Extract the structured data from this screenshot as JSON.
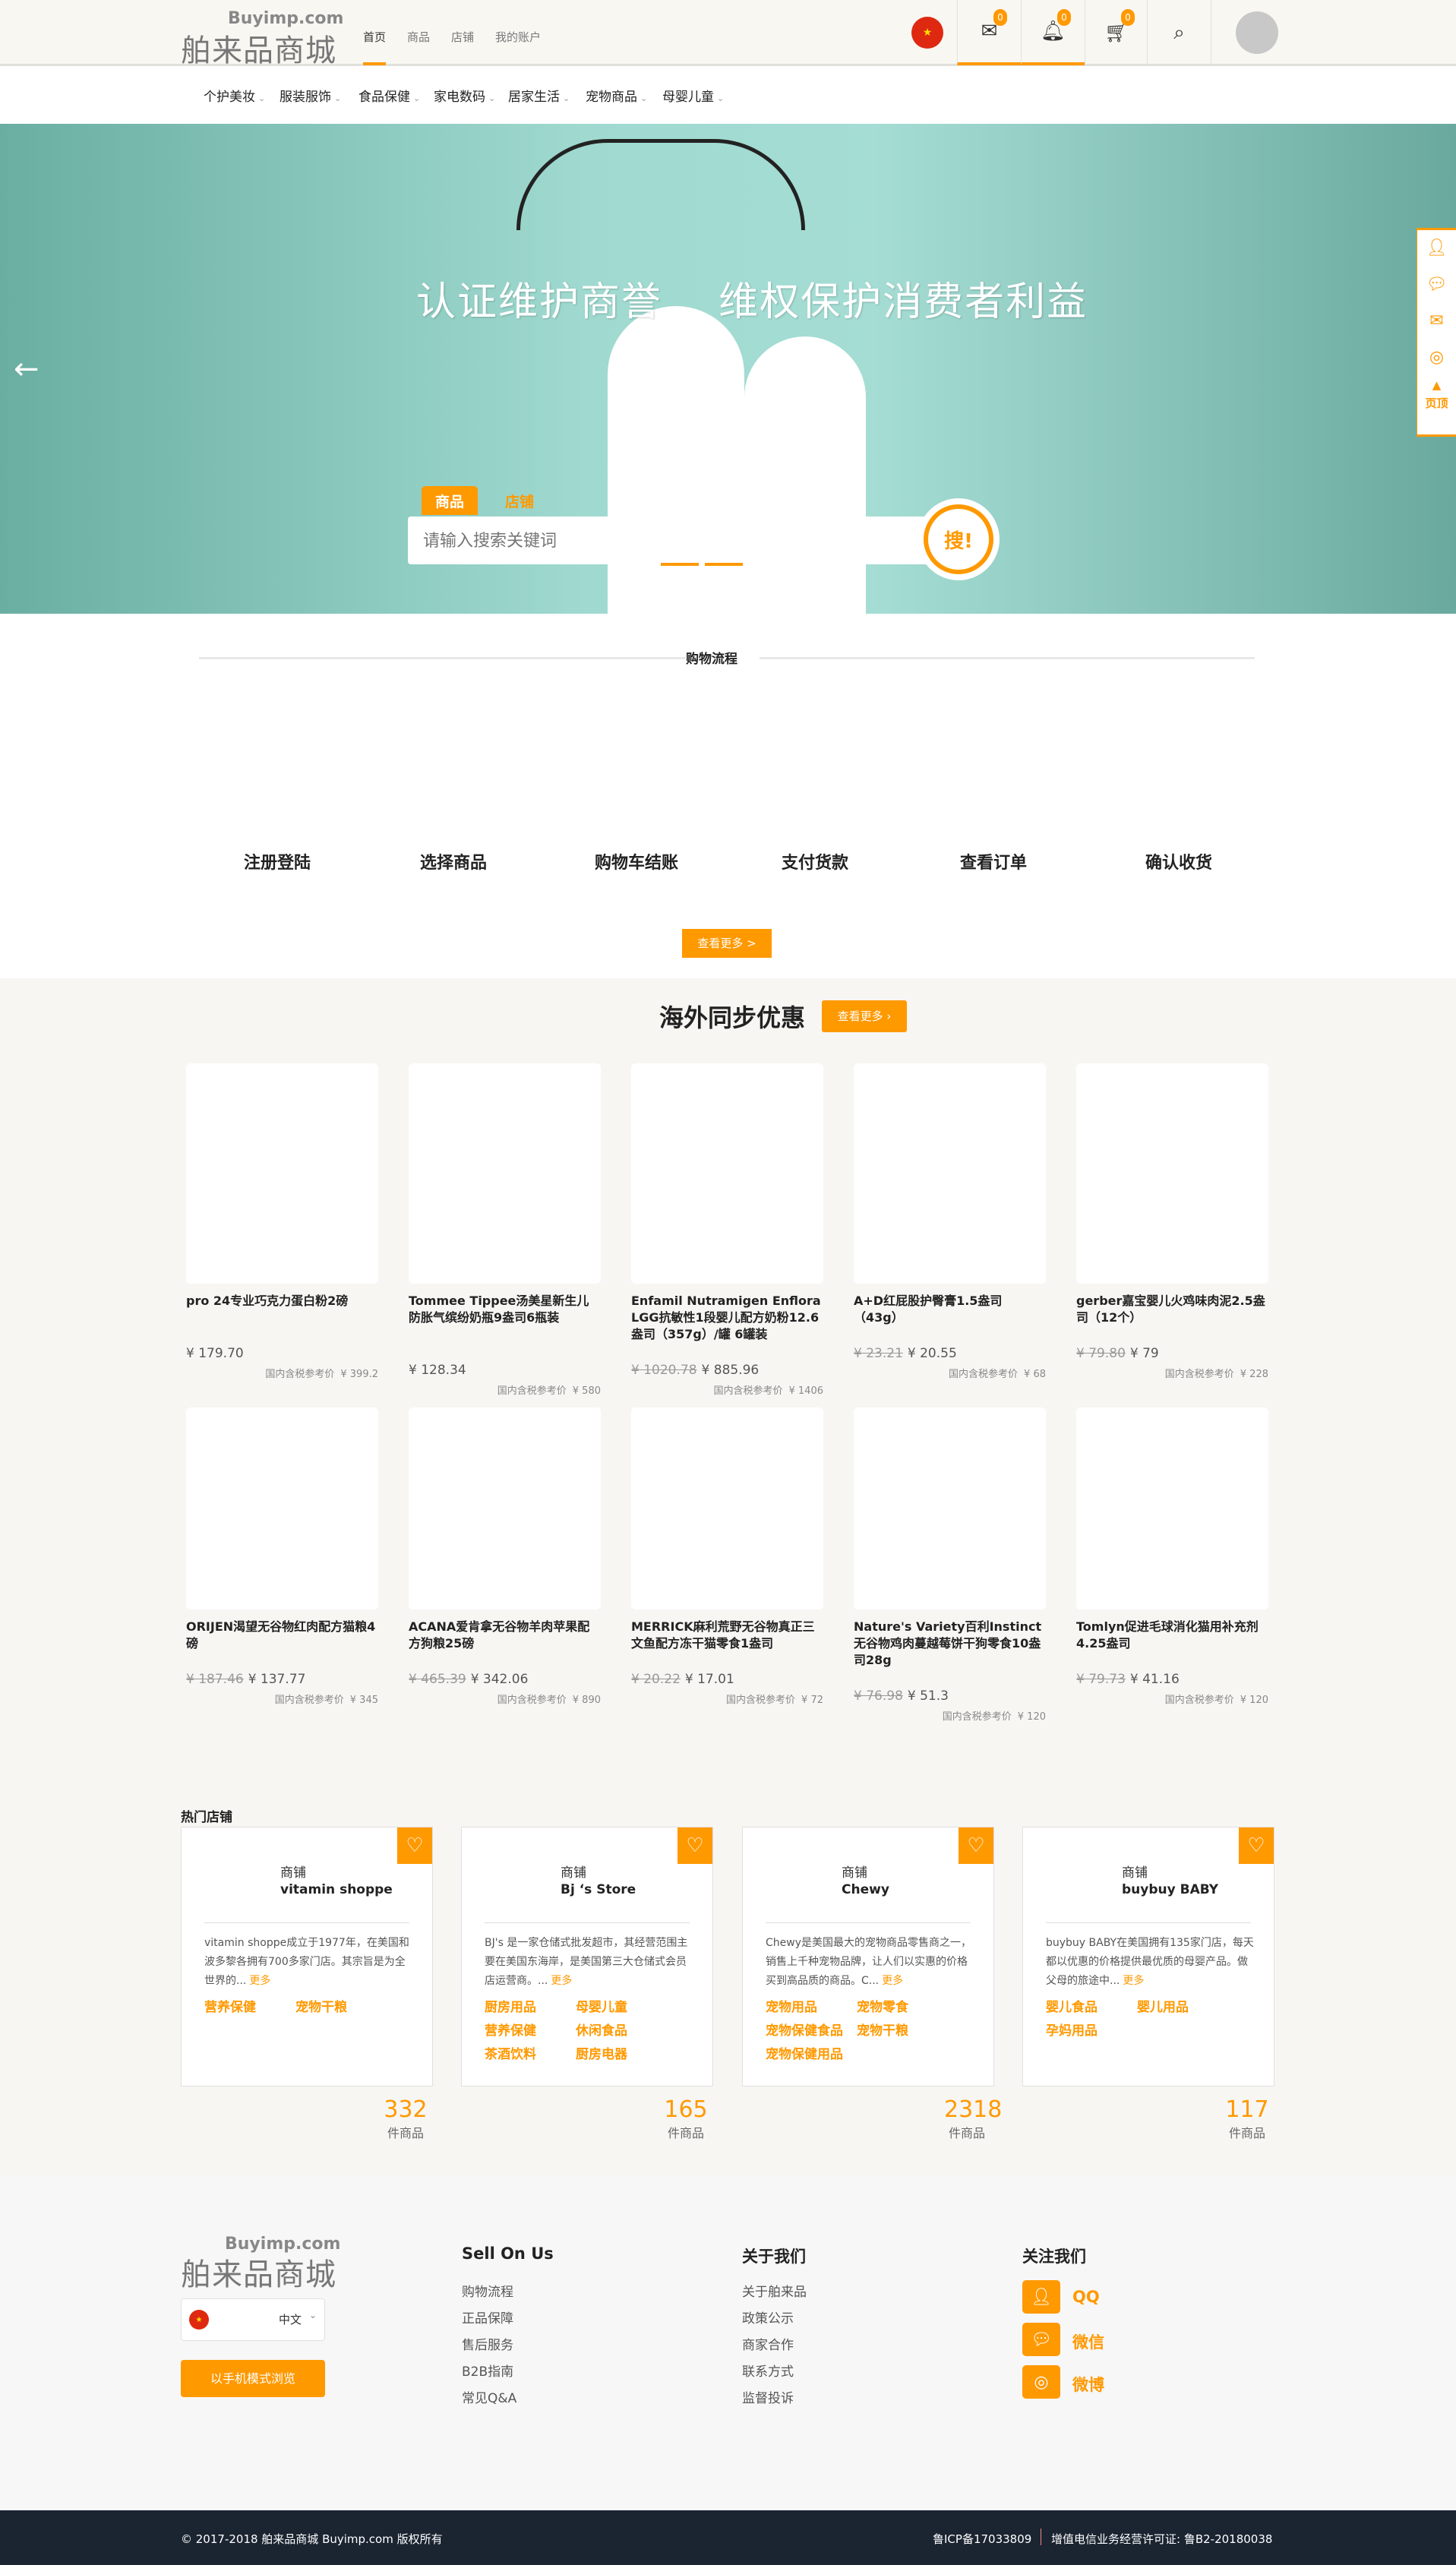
{
  "header": {
    "logo_top": "Buyimp.com",
    "logo_main": "舶来品商城",
    "links": [
      "首页",
      "商品",
      "店铺",
      "我的账户"
    ],
    "message_count": "0",
    "notify_count": "0",
    "cart_count": "0"
  },
  "categories": [
    "个护美妆",
    "服装服饰",
    "食品保健",
    "家电数码",
    "居家生活",
    "宠物商品",
    "母婴儿童"
  ],
  "hero": {
    "slogan": "认证维护商誉    维权保护消费者利益",
    "tabs": [
      "商品",
      "店铺"
    ],
    "search_placeholder": "请输入搜索关键词",
    "search_button": "搜!"
  },
  "process": {
    "title": "购物流程",
    "steps": [
      "注册登陆",
      "选择商品",
      "购物车结账",
      "支付货款",
      "查看订单",
      "确认收货"
    ],
    "more": "查看更多 >"
  },
  "deals": {
    "title": "海外同步优惠",
    "more": "查看更多 ›",
    "ref_label": "国内含税参考价",
    "products": [
      {
        "name": "pro 24专业巧克力蛋白粉2磅",
        "old": "",
        "price": "¥ 179.70",
        "ref": "¥ 399.2"
      },
      {
        "name": "Tommee Tippee汤美星新生儿防胀气缤纷奶瓶9盎司6瓶装",
        "old": "",
        "price": "¥ 128.34",
        "ref": "¥ 580"
      },
      {
        "name": "Enfamil Nutramigen Enflora LGG抗敏性1段婴儿配方奶粉12.6盎司（357g）/罐 6罐装",
        "old": "¥ 1020.78",
        "price": "¥ 885.96",
        "ref": "¥ 1406"
      },
      {
        "name": "A+D红屁股护臀膏1.5盎司（43g）",
        "old": "¥ 23.21",
        "price": "¥ 20.55",
        "ref": "¥ 68"
      },
      {
        "name": "gerber嘉宝婴儿火鸡味肉泥2.5盎司（12个）",
        "old": "¥ 79.80",
        "price": "¥ 79",
        "ref": "¥ 228"
      },
      {
        "name": "ORIJEN渴望无谷物红肉配方猫粮4磅",
        "old": "¥ 187.46",
        "price": "¥ 137.77",
        "ref": "¥ 345"
      },
      {
        "name": "ACANA爱肯拿无谷物羊肉苹果配方狗粮25磅",
        "old": "¥ 465.39",
        "price": "¥ 342.06",
        "ref": "¥ 890"
      },
      {
        "name": "MERRICK麻利荒野无谷物真正三文鱼配方冻干猫零食1盎司",
        "old": "¥ 20.22",
        "price": "¥ 17.01",
        "ref": "¥ 72"
      },
      {
        "name": "Nature's Variety百利Instinct无谷物鸡肉蔓越莓饼干狗零食10盎司28g",
        "old": "¥ 76.98",
        "price": "¥ 51.3",
        "ref": "¥ 120"
      },
      {
        "name": "Tomlyn促进毛球消化猫用补充剂4.25盎司",
        "old": "¥ 79.73",
        "price": "¥ 41.16",
        "ref": "¥ 120"
      }
    ]
  },
  "stores": {
    "title": "热门店铺",
    "label": "商铺",
    "more": "更多",
    "unit": "件商品",
    "items": [
      {
        "name": "vitamin shoppe",
        "desc": "vitamin shoppe成立于1977年，在美国和波多黎各拥有700多家门店。其宗旨是为全世界的...",
        "tags": [
          "营养保健",
          "宠物干粮"
        ],
        "count": "332"
      },
      {
        "name": "Bj ‘s Store",
        "desc": "BJ's 是一家仓储式批发超市，其经营范围主要在美国东海岸，是美国第三大仓储式会员店运营商。...",
        "tags": [
          "厨房用品",
          "母婴儿童",
          "营养保健",
          "休闲食品",
          "茶酒饮料",
          "厨房电器"
        ],
        "count": "165"
      },
      {
        "name": "Chewy",
        "desc": "Chewy是美国最大的宠物商品零售商之一，销售上千种宠物品牌，让人们以实惠的价格买到高品质的商品。C...",
        "tags": [
          "宠物用品",
          "宠物零食",
          "宠物保健食品",
          "宠物干粮",
          "宠物保健用品"
        ],
        "count": "2318"
      },
      {
        "name": "buybuy BABY",
        "desc": "buybuy BABY在美国拥有135家门店，每天都以优惠的价格提供最优质的母婴产品。做父母的旅途中...",
        "tags": [
          "婴儿食品",
          "婴儿用品",
          "孕妈用品"
        ],
        "count": "117"
      }
    ]
  },
  "footer": {
    "logo_top": "Buyimp.com",
    "logo_main": "舶来品商城",
    "language": "中文",
    "mobile_button": "以手机模式浏览",
    "columns": [
      {
        "title": "Sell On Us",
        "links": [
          "购物流程",
          "正品保障",
          "售后服务",
          "B2B指南",
          "常见Q&A"
        ]
      },
      {
        "title": "关于我们",
        "links": [
          "关于舶来品",
          "政策公示",
          "商家合作",
          "联系方式",
          "监督投诉"
        ]
      }
    ],
    "follow_title": "关注我们",
    "social": [
      "QQ",
      "微信",
      "微博"
    ],
    "copyright": "© 2017-2018 舶来品商城 Buyimp.com 版权所有",
    "icp": "鲁ICP备17033809",
    "license": "增值电信业务经营许可证: 鲁B2-20180038"
  },
  "float_bar": {
    "top_label": "页顶"
  },
  "colors": {
    "accent": "#ff9900",
    "footer_bar": "#1b2431",
    "hero": "#9fd9cf"
  }
}
